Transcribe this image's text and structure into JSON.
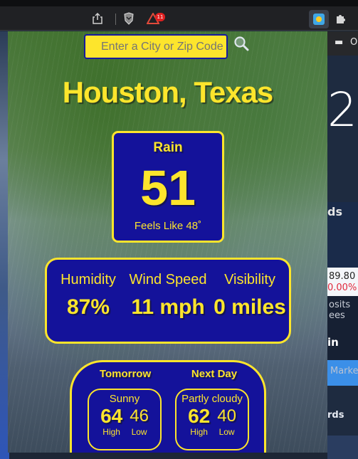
{
  "toolbar": {
    "share_icon": "share-icon",
    "brave_icon": "brave-shield-icon",
    "rewards_icon": "brave-rewards-icon",
    "rewards_badge": "11",
    "weather_ext_icon": "weather-extension-icon",
    "extensions_icon": "puzzle-icon"
  },
  "background_page": {
    "bookmark_folder": "O",
    "big_number": "2",
    "card_title_fragment": "ds",
    "price": "89.80",
    "change": "0.00%",
    "deposits_line1": "osits",
    "deposits_line2": "ees",
    "button_fragment": "in",
    "markets_fragment": "Marke",
    "cards_fragment": "rds"
  },
  "search": {
    "placeholder": "Enter a City or Zip Code",
    "button_icon": "magnifier-icon"
  },
  "location": "Houston, Texas",
  "current": {
    "condition": "Rain",
    "temperature": "51",
    "feels_like": "Feels Like 48˚"
  },
  "stats": {
    "humidity_label": "Humidity",
    "humidity_value": "87%",
    "wind_label": "Wind Speed",
    "wind_value": "11 mph",
    "visibility_label": "Visibility",
    "visibility_value": "0 miles"
  },
  "forecast": [
    {
      "day": "Tomorrow",
      "condition": "Sunny",
      "high": "64",
      "low": "46",
      "high_label": "High",
      "low_label": "Low"
    },
    {
      "day": "Next Day",
      "condition": "Partly cloudy",
      "high": "62",
      "low": "40",
      "high_label": "High",
      "low_label": "Low"
    }
  ],
  "colors": {
    "accent_yellow": "#fde52c",
    "panel_blue": "#14129a"
  }
}
